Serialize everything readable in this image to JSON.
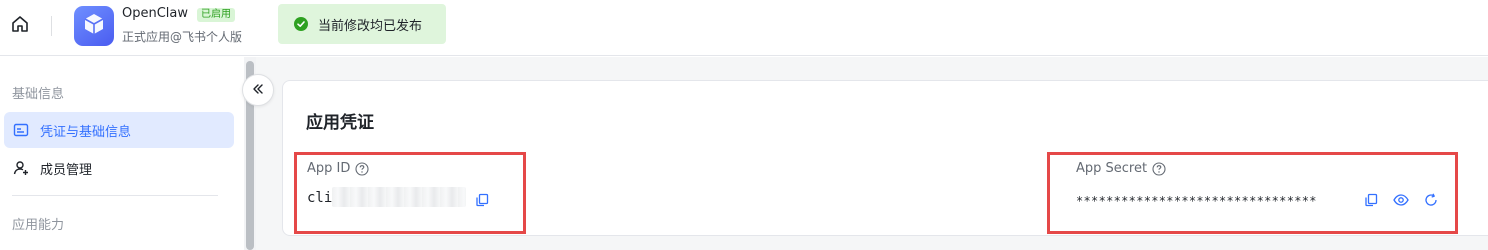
{
  "app": {
    "name": "OpenClaw",
    "status_badge": "已启用",
    "subtitle": "正式应用@飞书个人版"
  },
  "toast": {
    "message": "当前修改均已发布"
  },
  "sidebar": {
    "section_basic": "基础信息",
    "items": [
      {
        "label": "凭证与基础信息",
        "icon": "credential-icon",
        "active": true
      },
      {
        "label": "成员管理",
        "icon": "add-member-icon",
        "active": false
      }
    ],
    "section_capability": "应用能力"
  },
  "credentials": {
    "title": "应用凭证",
    "app_id": {
      "label": "App ID",
      "value_prefix": "cli_"
    },
    "app_secret": {
      "label": "App Secret",
      "value": "********************************"
    }
  },
  "colors": {
    "accent": "#3370ff",
    "success": "#2ea121",
    "highlight_border": "#e54848"
  }
}
